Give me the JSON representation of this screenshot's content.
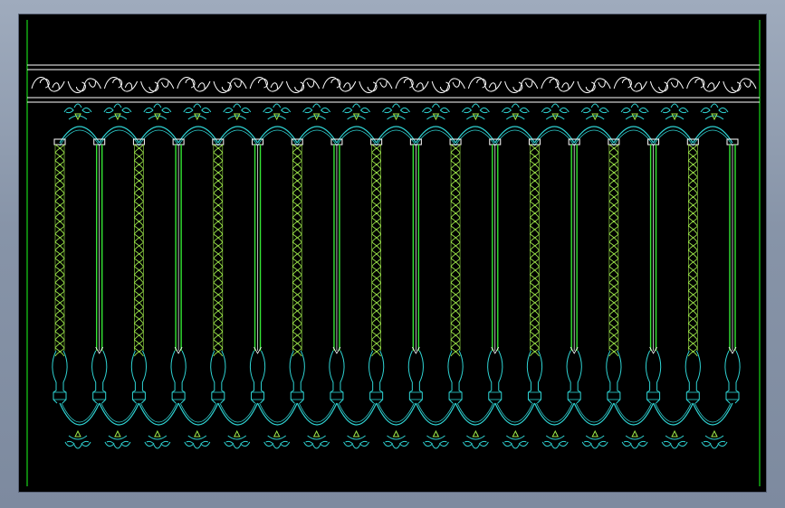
{
  "colors": {
    "background": "#000000",
    "frame": "#8895aa",
    "border_line": "#17d617",
    "frieze": "#ffffff",
    "ornament": "#2fd3d3",
    "rope": "#9ee84a",
    "bar": "#34e634",
    "bar_core": "#ffffff"
  },
  "drawing": {
    "balusters": [
      "rope",
      "bar",
      "rope",
      "bar",
      "rope",
      "bar",
      "rope",
      "bar",
      "rope",
      "bar",
      "rope",
      "bar",
      "rope",
      "bar",
      "rope",
      "bar",
      "rope",
      "bar"
    ]
  }
}
